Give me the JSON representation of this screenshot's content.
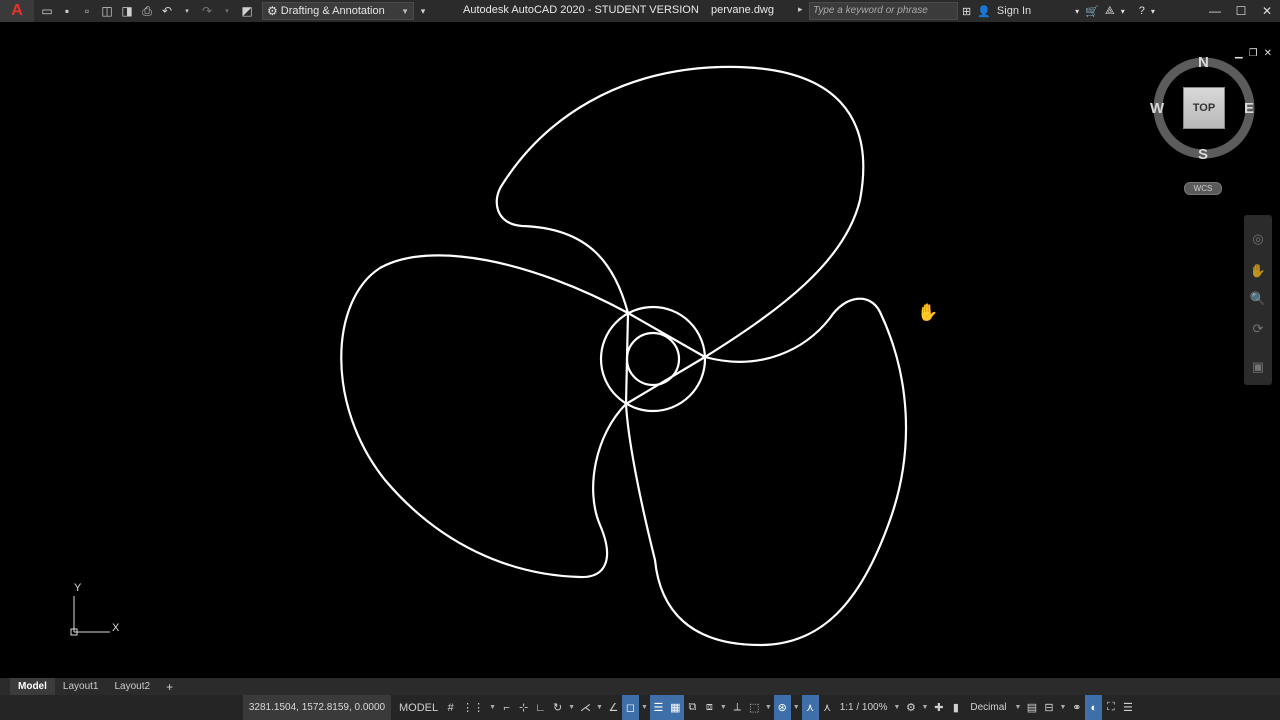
{
  "titlebar": {
    "app_logo": "A",
    "workspace": "Drafting & Annotation",
    "title": "Autodesk AutoCAD 2020 - STUDENT VERSION    pervane.dwg",
    "search_placeholder": "Type a keyword or phrase",
    "sign_in": "Sign In"
  },
  "viewcube": {
    "north": "N",
    "south": "S",
    "east": "E",
    "west": "W",
    "face": "TOP",
    "wcs": "WCS"
  },
  "ucs": {
    "x_label": "X",
    "y_label": "Y"
  },
  "layout_tabs": [
    "Model",
    "Layout1",
    "Layout2"
  ],
  "statusbar": {
    "coordinates": "3281.1504, 1572.8159, 0.0000",
    "model": "MODEL",
    "scale": "1:1 / 100%",
    "units": "Decimal"
  },
  "colors": {
    "background": "#000000",
    "linework": "#ffffff",
    "toggle_on": "#3e6fa8",
    "chrome": "#2b2b2b"
  }
}
